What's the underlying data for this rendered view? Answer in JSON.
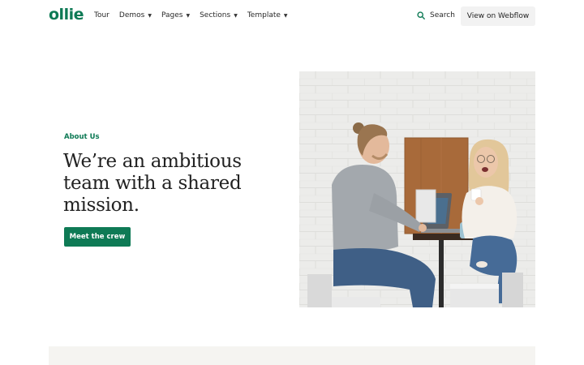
{
  "nav": {
    "logo": "ollie",
    "items": [
      {
        "label": "Tour",
        "dropdown": false
      },
      {
        "label": "Demos",
        "dropdown": true
      },
      {
        "label": "Pages",
        "dropdown": true
      },
      {
        "label": "Sections",
        "dropdown": true
      },
      {
        "label": "Template",
        "dropdown": true
      }
    ],
    "caret": "▼",
    "search_label": "Search",
    "cta_label": "View on Webflow"
  },
  "hero": {
    "eyebrow": "About Us",
    "headline": "We’re an ambitious team with a shared mission.",
    "button_label": "Meet the crew"
  },
  "colors": {
    "brand": "#0e7a55",
    "nav_button_bg": "#f2f2f2",
    "strip_bg": "#f5f4f1"
  }
}
